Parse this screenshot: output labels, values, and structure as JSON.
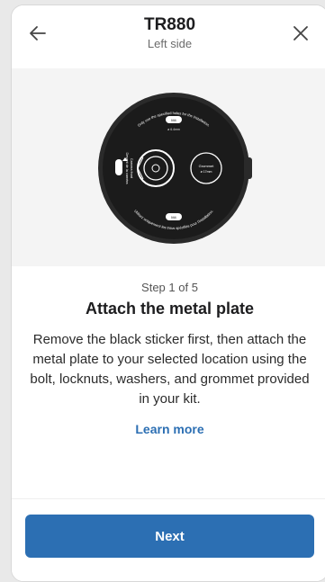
{
  "header": {
    "title": "TR880",
    "subtitle": "Left side",
    "back_icon": "arrow-left-icon",
    "close_icon": "close-icon"
  },
  "illustration": {
    "top_text": "Only use the specified holes for the installation.",
    "bottom_text": "Utilisez uniquement les trous spécifiés pour l'installation.",
    "left_text_1": "Camera front",
    "left_text_2": "Devant de la caméra",
    "grommet_label": "Grommet",
    "grommet_size": "ø 17mm",
    "hole_size": "ø 6.4mm",
    "hole_label": "M4"
  },
  "content": {
    "step": "Step 1 of 5",
    "heading": "Attach the metal plate",
    "description": "Remove the black sticker first, then attach the metal plate to your selected location using the bolt, locknuts, washers, and grommet provided in your kit.",
    "learn_more": "Learn more"
  },
  "footer": {
    "next_label": "Next"
  },
  "colors": {
    "accent": "#2c6fb3",
    "image_bg": "#f4f4f4",
    "device": "#1b1b1b"
  }
}
